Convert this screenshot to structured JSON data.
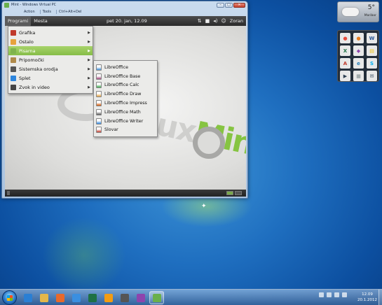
{
  "vm_window": {
    "title": "Mint - Windows Virtual PC",
    "menu": [
      "Action",
      "Tools",
      "Ctrl+Alt+Del"
    ],
    "controls": [
      "–",
      "▢",
      "✕"
    ]
  },
  "mint_panel": {
    "menus": [
      "Programi",
      "Mesta"
    ],
    "clock": "pet 20. jan, 12.09",
    "user": "Zoran"
  },
  "apps_menu": {
    "items": [
      {
        "label": "Grafika",
        "icon": "graphics-icon",
        "color": "#c0392b"
      },
      {
        "label": "Ostalo",
        "icon": "other-icon",
        "color": "#e6a23c"
      },
      {
        "label": "Pisarna",
        "icon": "office-icon",
        "color": "#7fb24d",
        "active": true
      },
      {
        "label": "Pripomočki",
        "icon": "accessories-icon",
        "color": "#b08a4a"
      },
      {
        "label": "Sistemska orodja",
        "icon": "system-tools-icon",
        "color": "#555555"
      },
      {
        "label": "Splet",
        "icon": "internet-icon",
        "color": "#2e86de"
      },
      {
        "label": "Zvok in video",
        "icon": "sound-video-icon",
        "color": "#444444"
      }
    ]
  },
  "submenu": {
    "items": [
      {
        "label": "LibreOffice",
        "color": "#3d8ed6"
      },
      {
        "label": "LibreOffice Base",
        "color": "#a0457a"
      },
      {
        "label": "LibreOffice Calc",
        "color": "#3aa64a"
      },
      {
        "label": "LibreOffice Draw",
        "color": "#e6a23c"
      },
      {
        "label": "LibreOffice Impress",
        "color": "#d35400"
      },
      {
        "label": "LibreOffice Math",
        "color": "#555555"
      },
      {
        "label": "LibreOffice Writer",
        "color": "#2e86de"
      },
      {
        "label": "Slovar",
        "color": "#c0392b"
      }
    ]
  },
  "wallpaper_logo": {
    "lx": "linux",
    "mint": "Mint"
  },
  "weather": {
    "temp": "5°",
    "city": "Maribor"
  },
  "launcher": [
    {
      "name": "chrome-icon",
      "glyph": "●",
      "color": "#e74c3c"
    },
    {
      "name": "firefox-icon",
      "glyph": "●",
      "color": "#e67e22"
    },
    {
      "name": "word-icon",
      "glyph": "W",
      "color": "#2b5797"
    },
    {
      "name": "excel-icon",
      "glyph": "X",
      "color": "#1e7145"
    },
    {
      "name": "paint-icon",
      "glyph": "◆",
      "color": "#8e44ad"
    },
    {
      "name": "notes-icon",
      "glyph": "▤",
      "color": "#f1c40f"
    },
    {
      "name": "acrobat-icon",
      "glyph": "A",
      "color": "#c0392b"
    },
    {
      "name": "ie-icon",
      "glyph": "e",
      "color": "#2980b9"
    },
    {
      "name": "skype-icon",
      "glyph": "S",
      "color": "#00aff0"
    },
    {
      "name": "media-icon",
      "glyph": "▶",
      "color": "#2c3e50"
    },
    {
      "name": "gadget-icon",
      "glyph": "▦",
      "color": "#7f8c8d"
    },
    {
      "name": "mail-icon",
      "glyph": "✉",
      "color": "#34495e"
    }
  ],
  "taskbar": {
    "clock_time": "12.09",
    "clock_date": "20.1.2012",
    "buttons": [
      {
        "name": "taskbar-ie-button",
        "icon": "ie-icon",
        "color": "#2a7fd4",
        "open": false
      },
      {
        "name": "taskbar-explorer-button",
        "icon": "folder-icon",
        "color": "#e3b74b",
        "open": false
      },
      {
        "name": "taskbar-firefox-button",
        "icon": "firefox-icon",
        "color": "#e8692b",
        "open": false
      },
      {
        "name": "taskbar-ie2-button",
        "icon": "ie-icon",
        "color": "#3a8fe0",
        "open": false
      },
      {
        "name": "taskbar-excel-button",
        "icon": "excel-icon",
        "color": "#1e7145",
        "open": false
      },
      {
        "name": "taskbar-media-button",
        "icon": "media-player-icon",
        "color": "#f39c12",
        "open": false
      },
      {
        "name": "taskbar-terminal-button",
        "icon": "terminal-icon",
        "color": "#555555",
        "open": false
      },
      {
        "name": "taskbar-paint-button",
        "icon": "paint-icon",
        "color": "#8e44ad",
        "open": false
      },
      {
        "name": "taskbar-virtualpc-button",
        "icon": "virtual-pc-icon",
        "color": "#6ab04c",
        "open": true
      }
    ]
  }
}
